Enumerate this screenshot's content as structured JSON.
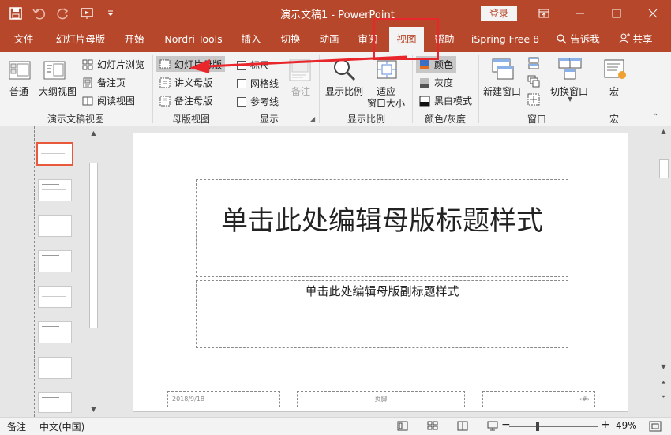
{
  "titlebar": {
    "title": "演示文稿1  -  PowerPoint",
    "login": "登录"
  },
  "tabs": [
    {
      "label": "文件",
      "x": 0
    },
    {
      "label": "幻灯片母版"
    },
    {
      "label": "开始"
    },
    {
      "label": "Nordri Tools"
    },
    {
      "label": "插入"
    },
    {
      "label": "切换"
    },
    {
      "label": "动画"
    },
    {
      "label": "审阅"
    },
    {
      "label": "视图"
    },
    {
      "label": "帮助"
    },
    {
      "label": "iSpring Free 8"
    },
    {
      "label": "告诉我"
    },
    {
      "label": "共享"
    }
  ],
  "ribbon": {
    "presentation_views": {
      "label": "演示文稿视图",
      "normal": "普通",
      "outline": "大纲视图",
      "slide_sorter": "幻灯片浏览",
      "notes_page": "备注页",
      "reading_view": "阅读视图"
    },
    "master_views": {
      "label": "母版视图",
      "slide_master": "幻灯片母版",
      "handout_master": "讲义母版",
      "notes_master": "备注母版"
    },
    "show": {
      "label": "显示",
      "ruler": "标尺",
      "gridlines": "网格线",
      "guides": "参考线",
      "notes": "备注"
    },
    "zoom": {
      "label": "显示比例",
      "zoom": "显示比例",
      "fit_line1": "适应",
      "fit_line2": "窗口大小"
    },
    "color": {
      "label": "颜色/灰度",
      "color": "颜色",
      "grayscale": "灰度",
      "bw": "黑白模式"
    },
    "window": {
      "label": "窗口",
      "new_window": "新建窗口",
      "switch_window": "切换窗口"
    },
    "macros": {
      "label": "宏",
      "macros": "宏"
    }
  },
  "slide": {
    "title_placeholder": "单击此处编辑母版标题样式",
    "subtitle_placeholder": "单击此处编辑母版副标题样式",
    "footer_date": "2018/9/18",
    "footer_center": "页脚",
    "footer_num": "‹#›"
  },
  "statusbar": {
    "notes": "备注",
    "language": "中文(中国)",
    "zoom": "49%",
    "minus": "−",
    "plus": "+"
  },
  "colors": {
    "accent": "#b7472a",
    "annotation": "#e8262b"
  }
}
